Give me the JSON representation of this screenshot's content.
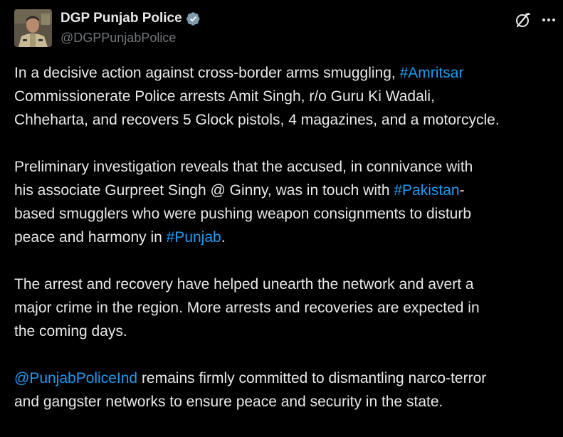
{
  "author": {
    "display_name": "DGP Punjab Police",
    "handle": "@DGPPunjabPolice",
    "verified": true
  },
  "actions": {
    "grok_icon": "grok-icon",
    "more_icon": "more-icon"
  },
  "colors": {
    "background": "#000000",
    "text": "#e7e9ea",
    "secondary": "#71767b",
    "link": "#1d9bf0",
    "verified_badge": "#829aab"
  },
  "tweet": {
    "p1": {
      "l1a": "In a decisive action against cross-border arms smuggling, ",
      "l1_tag": "#Amritsar",
      "l2": "Commissionerate Police arrests Amit Singh, r/o Guru Ki Wadali,",
      "l3": "Chheharta, and recovers 5 Glock pistols, 4 magazines, and a motorcycle."
    },
    "p2": {
      "l1": "Preliminary investigation reveals that the accused, in connivance with",
      "l2a": "his associate Gurpreet Singh @ Ginny, was in touch with ",
      "l2_tag": "#Pakistan",
      "l2b": "-",
      "l3": "based smugglers who were pushing weapon consignments to disturb",
      "l4a": "peace and harmony in ",
      "l4_tag": "#Punjab",
      "l4b": "."
    },
    "p3": {
      "l1": "The arrest and recovery have helped unearth the network and avert a",
      "l2": "major crime in the region. More arrests and recoveries are expected in",
      "l3": "the coming days."
    },
    "p4": {
      "l1_mention": "@PunjabPoliceInd",
      "l1b": " remains firmly committed to dismantling narco-terror",
      "l2": "and gangster networks to ensure peace and security in the state."
    }
  }
}
